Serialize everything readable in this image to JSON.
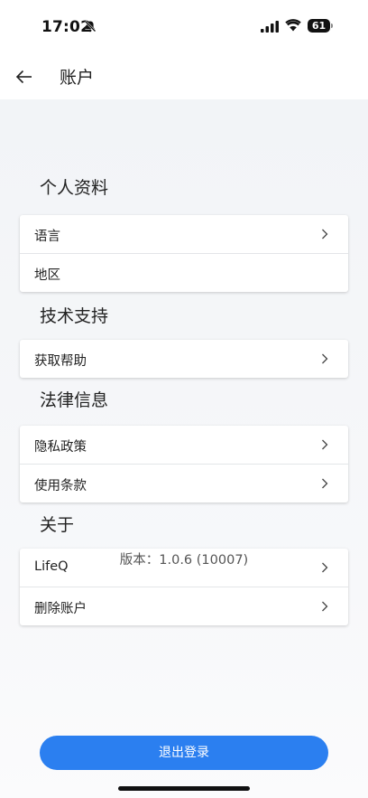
{
  "status_bar": {
    "time": "17:02",
    "battery": "61"
  },
  "header": {
    "title": "账户"
  },
  "sections": {
    "profile": {
      "title": "个人资料",
      "items": [
        {
          "label": "语言"
        },
        {
          "label": "地区"
        }
      ]
    },
    "support": {
      "title": "技术支持",
      "items": [
        {
          "label": "获取帮助"
        }
      ]
    },
    "legal": {
      "title": "法律信息",
      "items": [
        {
          "label": "隐私政策"
        },
        {
          "label": "使用条款"
        }
      ]
    },
    "about": {
      "title": "关于",
      "items": [
        {
          "label": "LifeQ"
        },
        {
          "label": "删除账户"
        }
      ]
    }
  },
  "version": "版本：1.0.6 (10007)",
  "logout_label": "退出登录",
  "colors": {
    "accent": "#2b7ff0",
    "background": "#f2f4f7"
  },
  "icons": [
    "bell-slash-icon",
    "signal-icon",
    "wifi-icon",
    "battery-icon",
    "back-arrow-icon",
    "chevron-right-icon"
  ]
}
